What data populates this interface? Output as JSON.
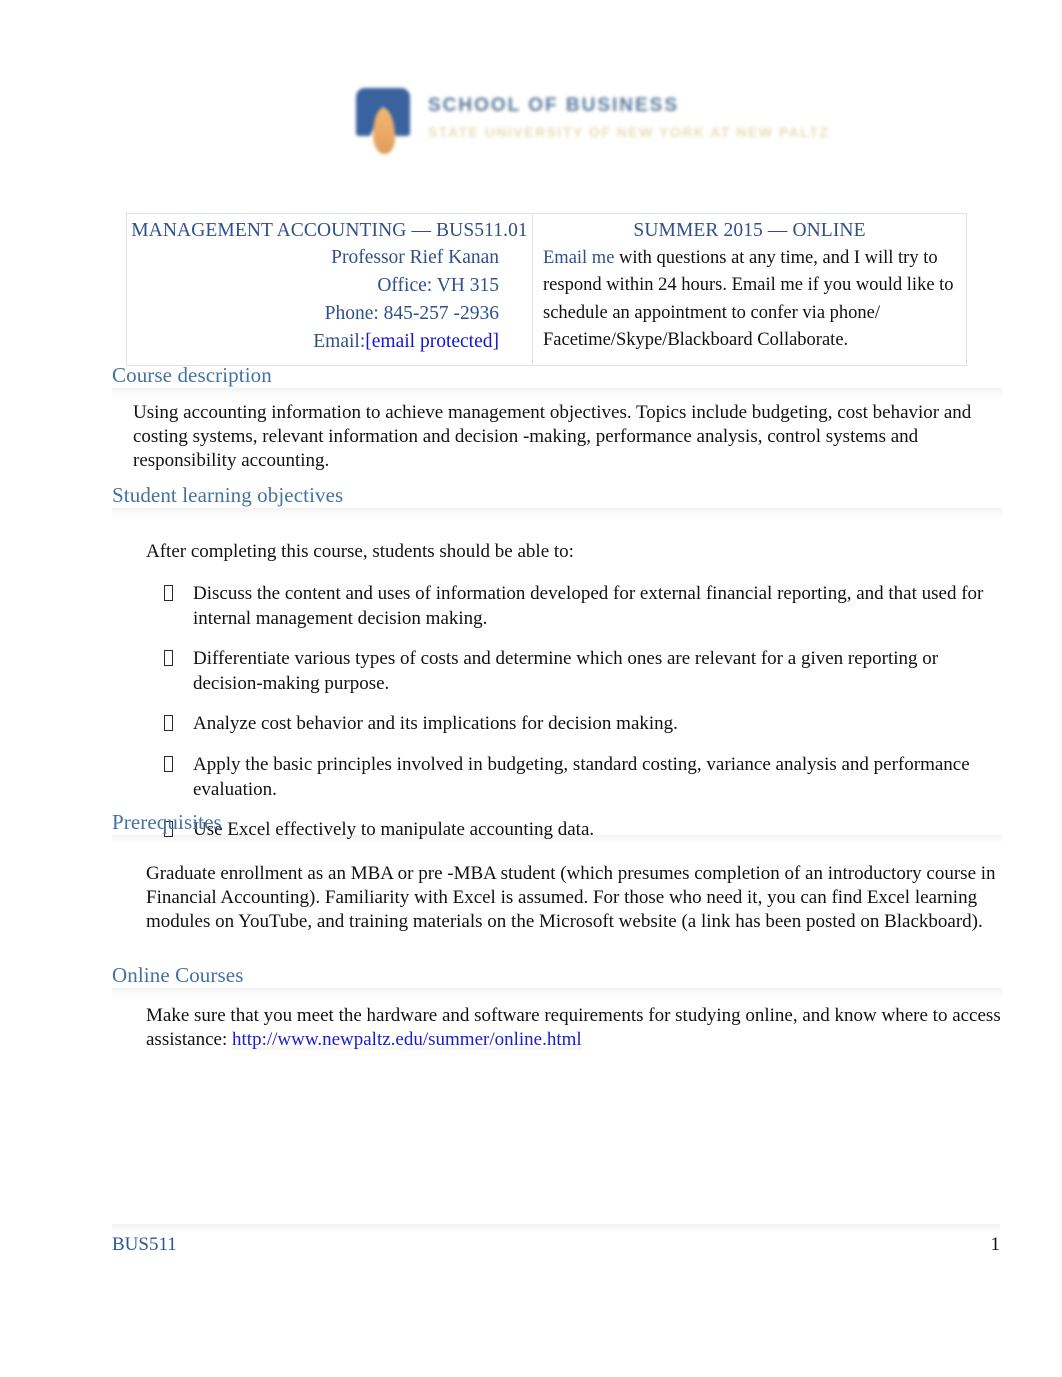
{
  "logo": {
    "title": "SCHOOL OF BUSINESS",
    "subtitle": "STATE UNIVERSITY OF NEW YORK AT NEW PALTZ"
  },
  "header_table": {
    "course_title": "MANAGEMENT ACCOUNTING — BUS511.01",
    "term_title": "SUMMER 2015 — ONLINE",
    "instructor": "Professor Rief Kanan",
    "office": "Office:  VH 315",
    "phone": "Phone:  845-257 -2936",
    "email_label": "Email:",
    "email_value": "[email protected]",
    "note_link": "Email me",
    "note_text": " with questions at any time, and I will try to respond within 24 hours.   Email me if you would like to schedule an appointment to confer via phone/ Facetime/Skype/Blackboard Collaborate."
  },
  "sections": {
    "course_description": {
      "heading": "Course description",
      "body": "Using accounting information to achieve management objectives. Topics include budgeting, cost behavior and costing systems, relevant information and decision -making, performance analysis, control systems and responsibility accounting."
    },
    "student_learning_objectives": {
      "heading": "Student learning objectives",
      "intro": "After completing this course, students should be able to:",
      "bullet_glyph": "missing-glyph-box",
      "items": [
        "Discuss the content and uses of information developed for external financial reporting, and that  used for internal management decision making.",
        "Differentiate various types of costs and determine which ones are relevant for a given reporting or decision-making purpose.",
        "Analyze cost behavior and its implications for decision making.",
        "Apply the basic principles involved in budgeting, standard costing, variance analysis and  performance evaluation.",
        "Use Excel effectively to manipulate accounting data."
      ]
    },
    "prerequisites": {
      "heading": "Prerequisites",
      "body": "Graduate enrollment as an MBA or pre -MBA student (which presumes completion of an introductory course in Financial Accounting). Familiarity with Excel is assumed. For those who need it, you can find Excel learning modules on YouTube, and training materials on the Microsoft website (a link has been posted on Blackboard)."
    },
    "online_courses": {
      "heading": "Online Courses",
      "body_before": "Make sure that you meet the hardware and software requirements for studying online, and know where to access assistance:  ",
      "link": "http://www.newpaltz.edu/summer/online.html"
    }
  },
  "footer": {
    "left": "BUS511",
    "right": "1"
  },
  "colors": {
    "heading_blue": "#4472a0",
    "table_blue": "#30508a",
    "hyperlink_blue": "#1414d6",
    "logo_blue": "#2a5596",
    "logo_orange": "#e8a159",
    "body_black": "#111111"
  }
}
